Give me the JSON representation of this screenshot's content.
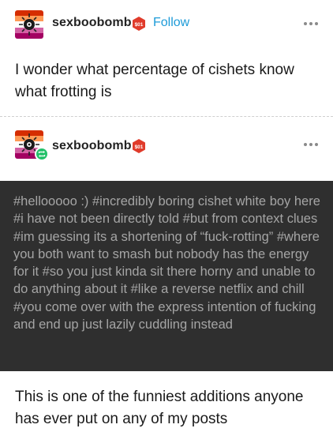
{
  "post1": {
    "username": "sexboobomb",
    "follow_label": "Follow",
    "badge_text": "$01",
    "avatar_icon": "bomb-avatar-icon",
    "text": "I wonder what percentage of cishets know what frotting is"
  },
  "post2": {
    "username": "sexboobomb",
    "badge_text": "$01",
    "avatar_icon": "bomb-avatar-icon",
    "reblog_icon": "reblog-icon",
    "tags": "#hellooooo :)  #incredibly boring cishet white boy here  #i have not been directly told  #but from context clues  #im guessing its a shortening of “fuck-rotting”  #where you both want to smash but nobody has the energy for it  #so you just kinda sit there horny and unable to do anything about it  #like a reverse netflix and chill  #you come over with the express intention of fucking and end up just lazily cuddling instead",
    "text": "This is one of the funniest additions anyone has ever put on any of my posts"
  },
  "colors": {
    "follow": "#1d9bd8",
    "tag_block_bg": "#2f2f2f",
    "tag_text": "#a5a5a5",
    "reblog": "#24c16a",
    "badge": "#e03b2b"
  }
}
